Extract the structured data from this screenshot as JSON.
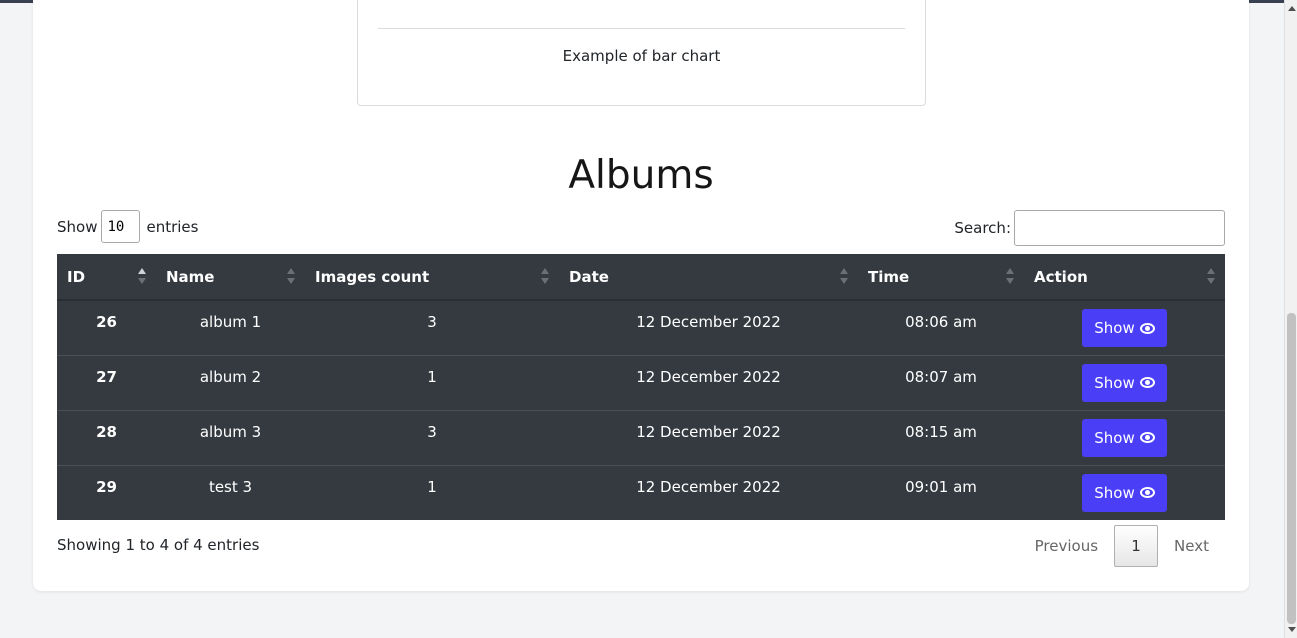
{
  "chart": {
    "caption": "Example of bar chart"
  },
  "albums": {
    "title": "Albums",
    "length": {
      "prefix": "Show",
      "value": "10",
      "suffix": "entries"
    },
    "search": {
      "label": "Search:",
      "value": ""
    },
    "columns": [
      "ID",
      "Name",
      "Images count",
      "Date",
      "Time",
      "Action"
    ],
    "rows": [
      {
        "id": "26",
        "name": "album 1",
        "images": "3",
        "date": "12 December 2022",
        "time": "08:06 am",
        "action": "Show"
      },
      {
        "id": "27",
        "name": "album 2",
        "images": "1",
        "date": "12 December 2022",
        "time": "08:07 am",
        "action": "Show"
      },
      {
        "id": "28",
        "name": "album 3",
        "images": "3",
        "date": "12 December 2022",
        "time": "08:15 am",
        "action": "Show"
      },
      {
        "id": "29",
        "name": "test 3",
        "images": "1",
        "date": "12 December 2022",
        "time": "09:01 am",
        "action": "Show"
      }
    ],
    "info": "Showing 1 to 4 of 4 entries",
    "pagination": {
      "previous": "Previous",
      "current": "1",
      "next": "Next"
    }
  },
  "colors": {
    "table_bg": "#343a40",
    "button": "#4a3ff7",
    "page_bg": "#f3f4f6"
  },
  "icons": {
    "action": "eye-icon"
  }
}
